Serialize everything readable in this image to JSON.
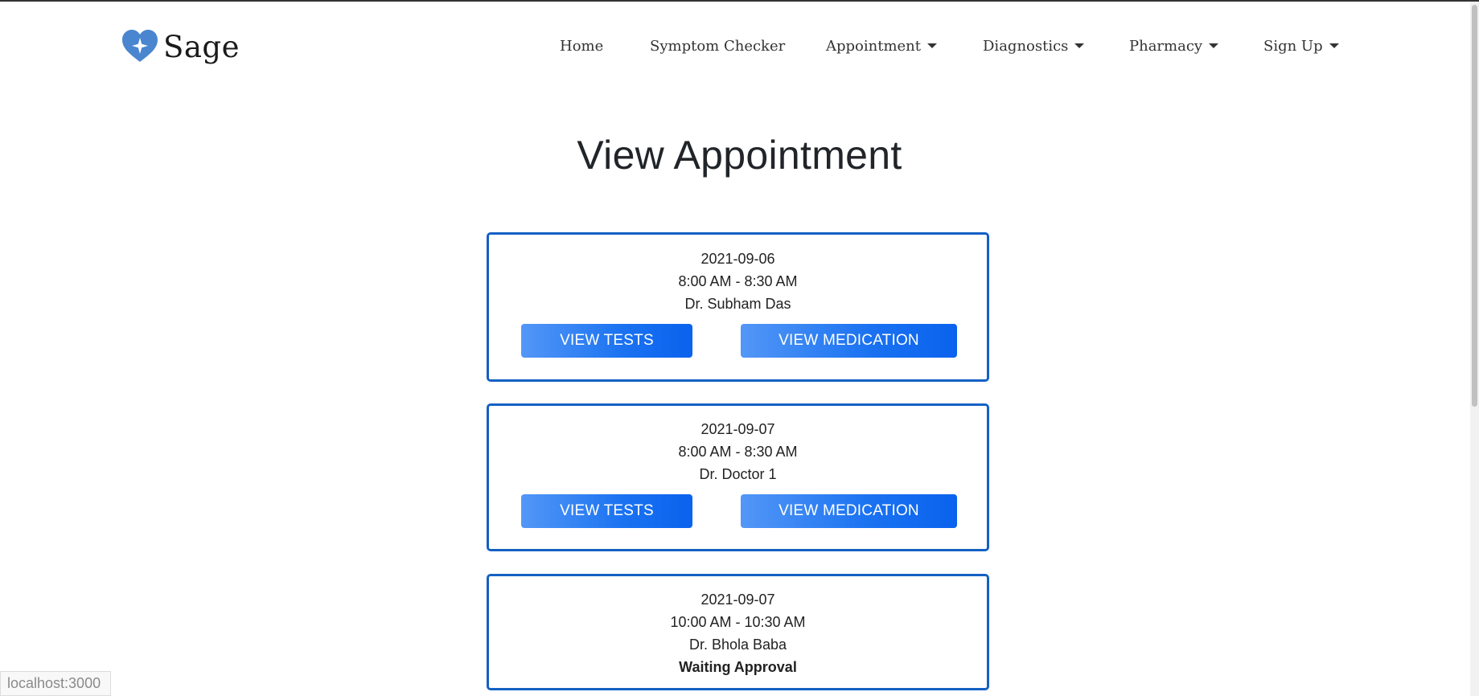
{
  "brand": {
    "name": "Sage"
  },
  "nav": {
    "items": [
      {
        "label": "Home",
        "dropdown": false
      },
      {
        "label": "Symptom Checker",
        "dropdown": false
      },
      {
        "label": "Appointment",
        "dropdown": true
      },
      {
        "label": "Diagnostics",
        "dropdown": true
      },
      {
        "label": "Pharmacy",
        "dropdown": true
      },
      {
        "label": "Sign Up",
        "dropdown": true
      }
    ]
  },
  "page": {
    "title": "View Appointment"
  },
  "appointments": [
    {
      "date": "2021-09-06",
      "time": "8:00 AM - 8:30 AM",
      "doctor": "Dr. Subham Das",
      "tests_label": "VIEW TESTS",
      "medication_label": "VIEW MEDICATION"
    },
    {
      "date": "2021-09-07",
      "time": "8:00 AM - 8:30 AM",
      "doctor": "Dr. Doctor 1",
      "tests_label": "VIEW TESTS",
      "medication_label": "VIEW MEDICATION"
    },
    {
      "date": "2021-09-07",
      "time": "10:00 AM - 10:30 AM",
      "doctor": "Dr. Bhola Baba",
      "status": "Waiting Approval"
    }
  ],
  "statusbar": {
    "url": "localhost:3000"
  },
  "colors": {
    "accent": "#1460c4",
    "button_start": "#5397f7",
    "button_end": "#0a62ee"
  },
  "icons": {
    "logo": "heart-sparkle-icon",
    "dropdown": "caret-down-icon"
  }
}
